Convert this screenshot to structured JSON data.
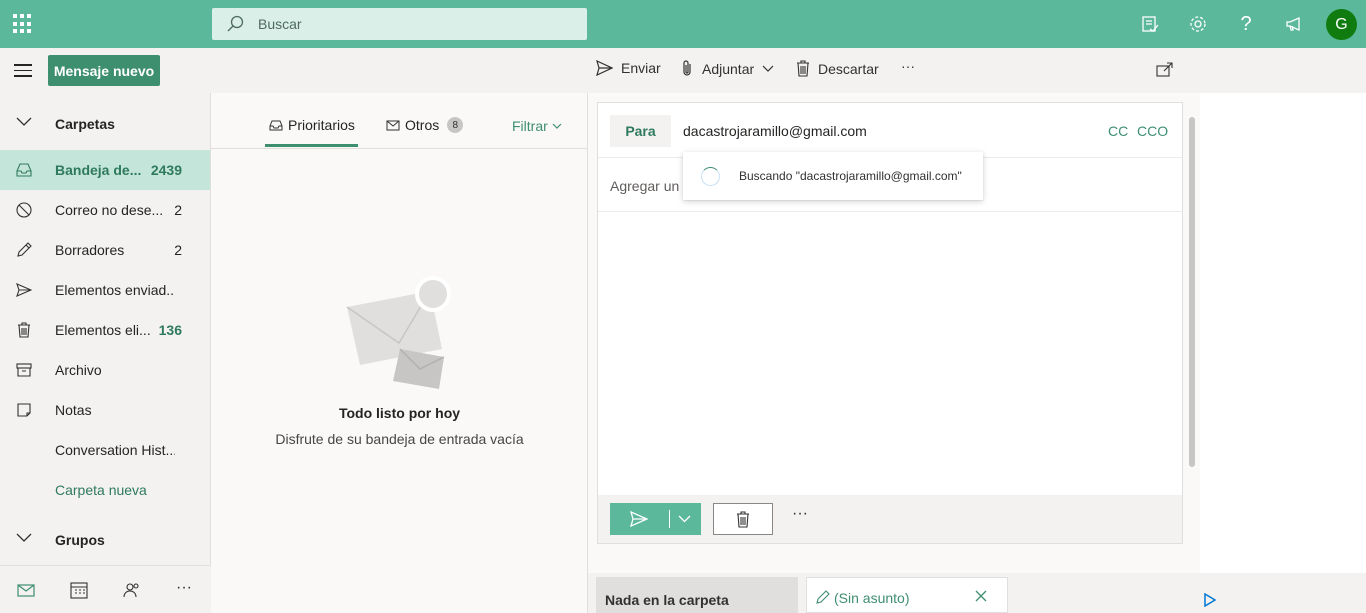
{
  "colors": {
    "brand": "#5bb89a",
    "brand_dark": "#3e8e70",
    "selected_bg": "#c4e5d9",
    "avatar_bg": "#107c10"
  },
  "topbar": {
    "search_placeholder": "Buscar",
    "icons": [
      "app-launcher-icon",
      "search-icon",
      "my-day-icon",
      "settings-icon",
      "help-icon",
      "feedback-icon"
    ],
    "avatar_initial": "G"
  },
  "commandbar": {
    "new_message": "Mensaje nuevo",
    "send": "Enviar",
    "attach": "Adjuntar",
    "discard": "Descartar",
    "more": "···"
  },
  "leftnav": {
    "folders_header": "Carpetas",
    "items": [
      {
        "label": "Bandeja de...",
        "count": "2439",
        "icon": "inbox-icon"
      },
      {
        "label": "Correo no dese...",
        "count": "2",
        "icon": "junk-icon"
      },
      {
        "label": "Borradores",
        "count": "2",
        "icon": "draft-pencil-icon"
      },
      {
        "label": "Elementos enviad...",
        "count": "",
        "icon": "sent-icon"
      },
      {
        "label": "Elementos eli...",
        "count": "136",
        "icon": "trash-icon"
      },
      {
        "label": "Archivo",
        "count": "",
        "icon": "archive-icon"
      },
      {
        "label": "Notas",
        "count": "",
        "icon": "notes-icon"
      },
      {
        "label": "Conversation Hist...",
        "count": "",
        "icon": ""
      },
      {
        "label": "Carpeta nueva",
        "count": "",
        "icon": ""
      }
    ],
    "groups_header": "Grupos",
    "bottom_icons": [
      "mail-icon",
      "calendar-icon",
      "people-icon",
      "more-icon"
    ],
    "bottom_more": "···"
  },
  "msglist": {
    "tab_focused": "Prioritarios",
    "tab_other": "Otros",
    "other_count": "8",
    "filter": "Filtrar",
    "empty_title": "Todo listo por hoy",
    "empty_subtitle": "Disfrute de su bandeja de entrada vacía"
  },
  "compose": {
    "to_label": "Para",
    "to_value": "dacastrojaramillo@gmail.com",
    "cc": "CC",
    "bcc": "CCO",
    "subject_placeholder": "Agregar un",
    "suggestion": "Buscando \"dacastrojaramillo@gmail.com\"",
    "more": "···"
  },
  "bottom_tabs": {
    "tab1": "Nada en la carpeta",
    "tab2": "(Sin asunto)"
  }
}
